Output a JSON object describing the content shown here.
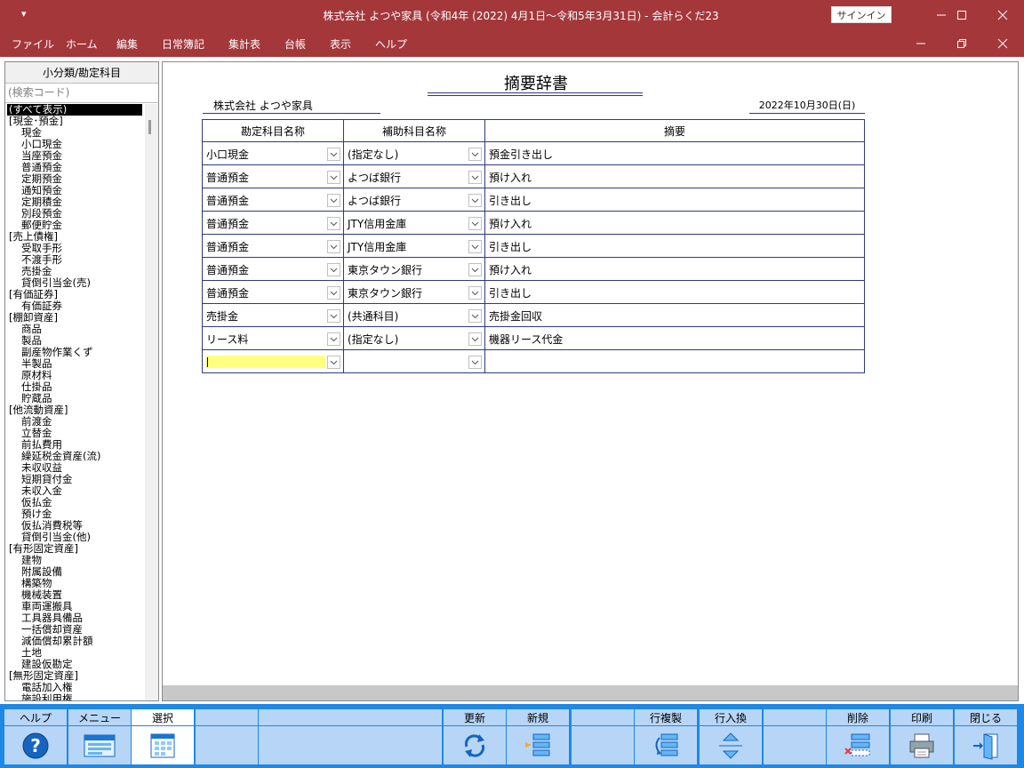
{
  "titlebar": {
    "quick_access": "▾",
    "title": "株式会社 よつや家具 (令和4年 (2022) 4月1日〜令和5年3月31日)  -  会計らくだ23",
    "signin": "サインイン"
  },
  "menubar": {
    "items": [
      "ファイル",
      "ホーム",
      "編集",
      "日常簿記",
      "集計表",
      "台帳",
      "表示",
      "ヘルプ"
    ]
  },
  "leftpanel": {
    "header": "小分類/勘定科目",
    "search_placeholder": "(検索コード)",
    "tree": [
      {
        "label": "(すべて表示)",
        "level": 0,
        "selected": true
      },
      {
        "label": "[現金･預金]",
        "level": 0
      },
      {
        "label": "現金",
        "level": 1
      },
      {
        "label": "小口現金",
        "level": 1
      },
      {
        "label": "当座預金",
        "level": 1
      },
      {
        "label": "普通預金",
        "level": 1
      },
      {
        "label": "定期預金",
        "level": 1
      },
      {
        "label": "通知預金",
        "level": 1
      },
      {
        "label": "定期積金",
        "level": 1
      },
      {
        "label": "別段預金",
        "level": 1
      },
      {
        "label": "郵便貯金",
        "level": 1
      },
      {
        "label": "[売上債権]",
        "level": 0
      },
      {
        "label": "受取手形",
        "level": 1
      },
      {
        "label": "不渡手形",
        "level": 1
      },
      {
        "label": "売掛金",
        "level": 1
      },
      {
        "label": "貸倒引当金(売)",
        "level": 1
      },
      {
        "label": "[有価証券]",
        "level": 0
      },
      {
        "label": "有価証券",
        "level": 1
      },
      {
        "label": "[棚卸資産]",
        "level": 0
      },
      {
        "label": "商品",
        "level": 1
      },
      {
        "label": "製品",
        "level": 1
      },
      {
        "label": "副産物作業くず",
        "level": 1
      },
      {
        "label": "半製品",
        "level": 1
      },
      {
        "label": "原材料",
        "level": 1
      },
      {
        "label": "仕掛品",
        "level": 1
      },
      {
        "label": "貯蔵品",
        "level": 1
      },
      {
        "label": "[他流動資産]",
        "level": 0
      },
      {
        "label": "前渡金",
        "level": 1
      },
      {
        "label": "立替金",
        "level": 1
      },
      {
        "label": "前払費用",
        "level": 1
      },
      {
        "label": "繰延税金資産(流)",
        "level": 1
      },
      {
        "label": "未収収益",
        "level": 1
      },
      {
        "label": "短期貸付金",
        "level": 1
      },
      {
        "label": "未収入金",
        "level": 1
      },
      {
        "label": "仮払金",
        "level": 1
      },
      {
        "label": "預け金",
        "level": 1
      },
      {
        "label": "仮払消費税等",
        "level": 1
      },
      {
        "label": "貸倒引当金(他)",
        "level": 1
      },
      {
        "label": "[有形固定資産]",
        "level": 0
      },
      {
        "label": "建物",
        "level": 1
      },
      {
        "label": "附属設備",
        "level": 1
      },
      {
        "label": "構築物",
        "level": 1
      },
      {
        "label": "機械装置",
        "level": 1
      },
      {
        "label": "車両運搬具",
        "level": 1
      },
      {
        "label": "工具器具備品",
        "level": 1
      },
      {
        "label": "一括償却資産",
        "level": 1
      },
      {
        "label": "減価償却累計額",
        "level": 1
      },
      {
        "label": "土地",
        "level": 1
      },
      {
        "label": "建設仮勘定",
        "level": 1
      },
      {
        "label": "[無形固定資産]",
        "level": 0
      },
      {
        "label": "電話加入権",
        "level": 1
      },
      {
        "label": "施設利用権",
        "level": 1
      }
    ]
  },
  "document": {
    "title": "摘要辞書",
    "company": "株式会社  よつや家具",
    "date": "2022年10月30日(日)",
    "columns": [
      "勘定科目名称",
      "補助科目名称",
      "摘要"
    ],
    "rows": [
      {
        "account": "小口現金",
        "sub": "(指定なし)",
        "memo": "預金引き出し"
      },
      {
        "account": "普通預金",
        "sub": "よつば銀行",
        "memo": "預け入れ"
      },
      {
        "account": "普通預金",
        "sub": "よつば銀行",
        "memo": "引き出し"
      },
      {
        "account": "普通預金",
        "sub": "JTY信用金庫",
        "memo": "預け入れ"
      },
      {
        "account": "普通預金",
        "sub": "JTY信用金庫",
        "memo": "引き出し"
      },
      {
        "account": "普通預金",
        "sub": "東京タウン銀行",
        "memo": "預け入れ"
      },
      {
        "account": "普通預金",
        "sub": "東京タウン銀行",
        "memo": "引き出し"
      },
      {
        "account": "売掛金",
        "sub": "(共通科目)",
        "memo": "売掛金回収"
      },
      {
        "account": "リース料",
        "sub": "(指定なし)",
        "memo": "機器リース代金"
      }
    ]
  },
  "toolbar": {
    "keys": [
      {
        "label": "ヘルプ",
        "icon": "help-icon"
      },
      {
        "label": "メニュー",
        "icon": "menu-icon"
      },
      {
        "label": "選択",
        "icon": "select-icon"
      },
      {
        "label": "",
        "icon": ""
      },
      {
        "label": "",
        "icon": ""
      },
      {
        "label": "更新",
        "icon": "refresh-icon"
      },
      {
        "label": "新規",
        "icon": "new-icon"
      },
      {
        "label": "",
        "icon": ""
      },
      {
        "label": "行複製",
        "icon": "duplicate-row-icon"
      },
      {
        "label": "行入換",
        "icon": "swap-rows-icon"
      },
      {
        "label": "",
        "icon": ""
      },
      {
        "label": "削除",
        "icon": "delete-icon"
      },
      {
        "label": "印刷",
        "icon": "print-icon"
      },
      {
        "label": "閉じる",
        "icon": "close-icon"
      }
    ]
  }
}
